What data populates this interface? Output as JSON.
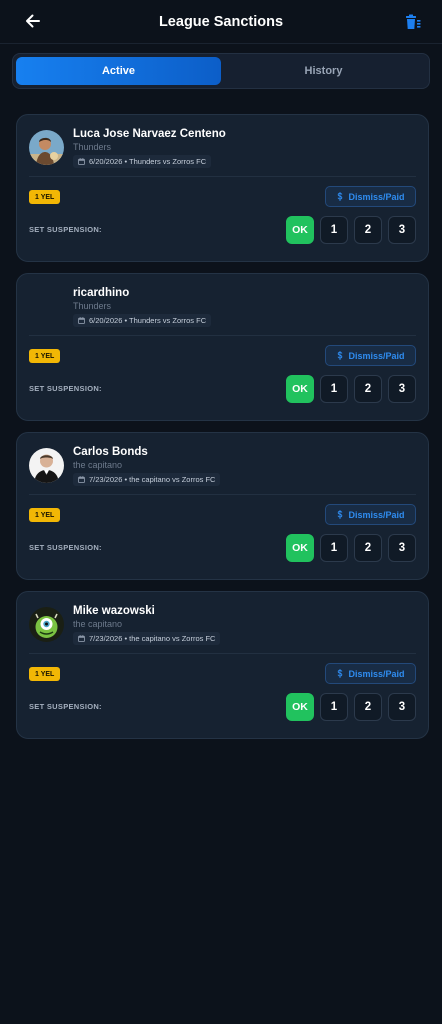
{
  "header": {
    "title": "League Sanctions",
    "back_icon": "arrow-left-icon",
    "action_icon": "trash-icon",
    "accent_color": "#1780f0"
  },
  "tabs": [
    {
      "label": "Active",
      "active": true
    },
    {
      "label": "History",
      "active": false
    }
  ],
  "labels": {
    "set_suspension": "SET SUSPENSION:",
    "dismiss": "Dismiss/Paid",
    "ok": "OK",
    "one": "1",
    "two": "2",
    "three": "3"
  },
  "sanctions": [
    {
      "player": "Luca Jose Narvaez Centeno",
      "team": "Thunders",
      "match": "6/20/2026 • Thunders vs Zorros FC",
      "card": "1 YEL",
      "avatar": "photo"
    },
    {
      "player": "ricardhino",
      "team": "Thunders",
      "match": "6/20/2026 • Thunders vs Zorros FC",
      "card": "1 YEL",
      "avatar": "none"
    },
    {
      "player": "Carlos Bonds",
      "team": "the capitano",
      "match": "7/23/2026 • the capitano vs Zorros FC",
      "card": "1 YEL",
      "avatar": "photo"
    },
    {
      "player": "Mike wazowski",
      "team": "the capitano",
      "match": "7/23/2026 • the capitano vs Zorros FC",
      "card": "1 YEL",
      "avatar": "photo"
    }
  ]
}
